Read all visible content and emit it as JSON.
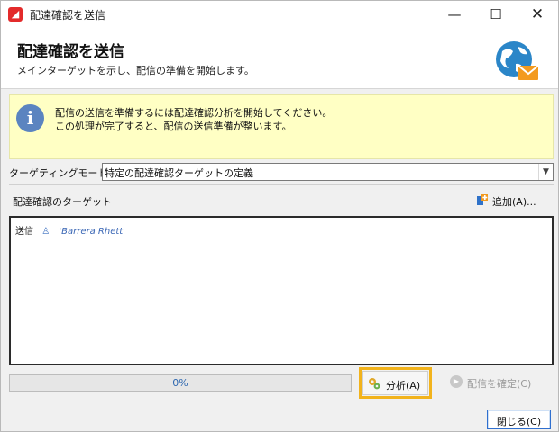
{
  "window": {
    "title": "配達確認を送信",
    "app_icon": "adobe-campaign-icon",
    "minimize_glyph": "—",
    "maximize_glyph": "☐",
    "close_glyph": "✕"
  },
  "header": {
    "title": "配達確認を送信",
    "subtitle": "メインターゲットを示し、配信の準備を開始します。",
    "icon": "globe-mail-icon"
  },
  "info": {
    "icon": "info-icon",
    "lines": [
      "配信の送信を準備するには配達確認分析を開始してください。",
      "この処理が完了すると、配信の送信準備が整います。"
    ]
  },
  "targeting": {
    "label": "ターゲティングモード:",
    "value": "特定の配達確認ターゲットの定義"
  },
  "targets": {
    "title": "配達確認のターゲット",
    "add_label": "追加(A)...",
    "rows": [
      {
        "kind": "送信",
        "icon": "recipient-icon",
        "name": "'Barrera Rhett'"
      }
    ]
  },
  "progress": {
    "text": "0%",
    "value": 0
  },
  "buttons": {
    "analyze": "分析(A)",
    "confirm": "配信を確定(C)",
    "close": "閉じる(C)"
  },
  "colors": {
    "accent": "#f2b31c",
    "info_bg": "#ffffc4",
    "link_blue": "#3b67b5"
  }
}
